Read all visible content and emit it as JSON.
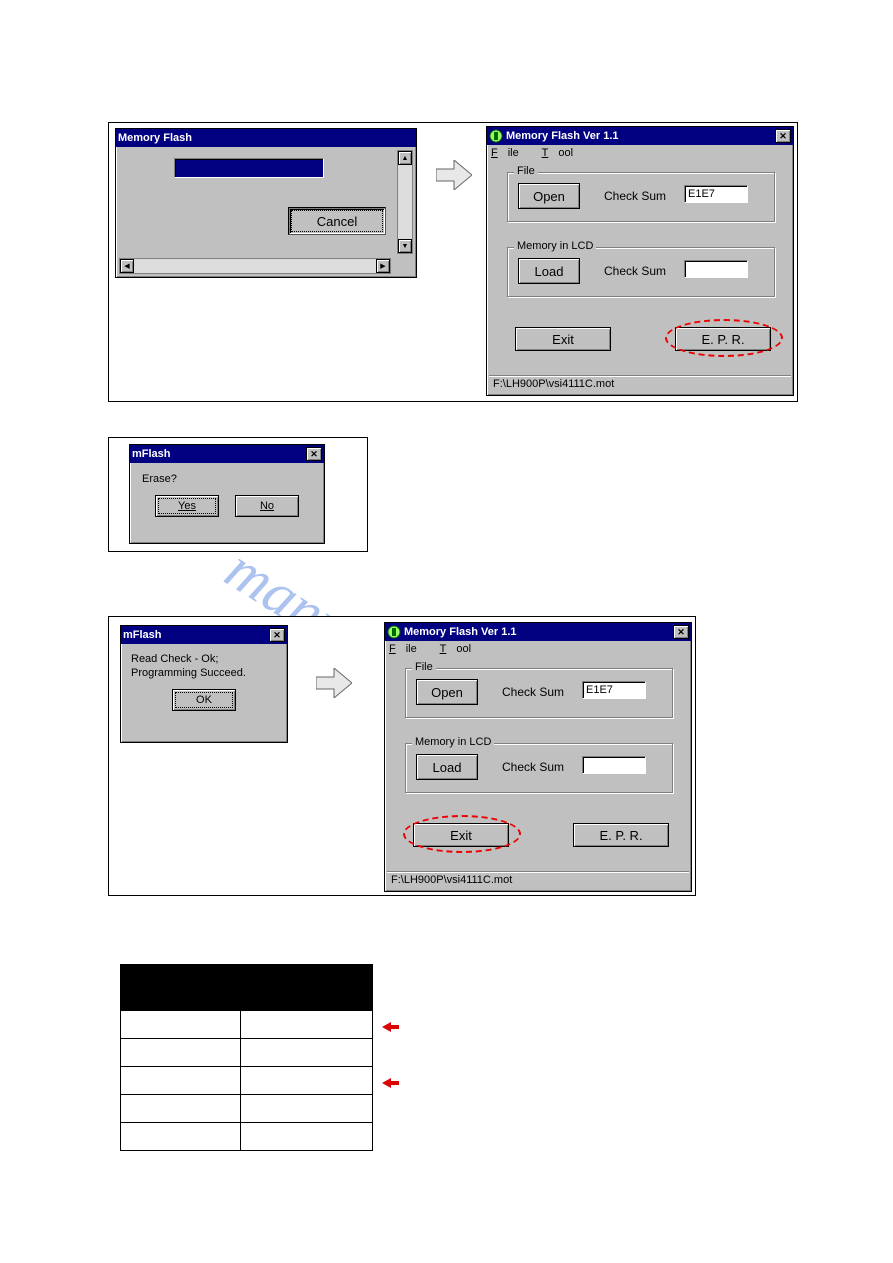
{
  "watermark_text": "manualshive.com",
  "panel1": {
    "progress_title": "Memory Flash",
    "cancel_label": "Cancel",
    "app_title": "Memory Flash  Ver 1.1",
    "menu_file_char": "F",
    "menu_file_rest": "ile",
    "menu_tool_char": "T",
    "menu_tool_rest": "ool",
    "fs_file_legend": "File",
    "open_label": "Open",
    "checksum_label1": "Check Sum",
    "checksum_value1": "E1E7",
    "fs_mem_legend": "Memory in LCD",
    "load_label": "Load",
    "checksum_label2": "Check Sum",
    "checksum_value2": "",
    "exit_label": "Exit",
    "epr_label": "E. P. R.",
    "status_path": "F:\\LH900P\\vsi4111C.mot"
  },
  "erase_dialog": {
    "title": "mFlash",
    "question": "Erase?",
    "yes_label": "Yes",
    "no_label": "No"
  },
  "panel3": {
    "msg_title": "mFlash",
    "msg_line1": "Read Check - Ok;",
    "msg_line2": "Programming Succeed.",
    "ok_label": "OK",
    "app_title": "Memory Flash  Ver 1.1",
    "menu_file_char": "F",
    "menu_file_rest": "ile",
    "menu_tool_char": "T",
    "menu_tool_rest": "ool",
    "fs_file_legend": "File",
    "open_label": "Open",
    "checksum_label1": "Check Sum",
    "checksum_value1": "E1E7",
    "fs_mem_legend": "Memory in LCD",
    "load_label": "Load",
    "checksum_label2": "Check Sum",
    "checksum_value2": "",
    "exit_label": "Exit",
    "epr_label": "E. P. R.",
    "status_path": "F:\\LH900P\\vsi4111C.mot"
  },
  "table": {
    "header": [
      "",
      ""
    ],
    "rows": [
      [
        "",
        ""
      ],
      [
        "",
        ""
      ],
      [
        "",
        ""
      ],
      [
        "",
        ""
      ],
      [
        "",
        ""
      ]
    ],
    "arrow_row_1": 0,
    "arrow_row_2": 2
  }
}
